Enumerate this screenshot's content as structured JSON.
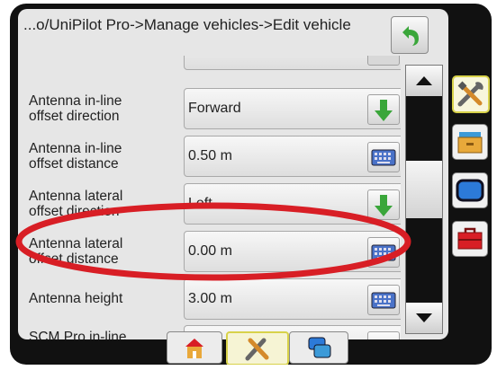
{
  "header": {
    "breadcrumb": "...o/UniPilot Pro->Manage vehicles->Edit vehicle",
    "back_icon": "back-arrow-icon"
  },
  "settings": [
    {
      "label_line1": "Antenna in-line",
      "label_line2": "offset direction",
      "value": "Forward",
      "control": "dropdown"
    },
    {
      "label_line1": "Antenna in-line",
      "label_line2": "offset distance",
      "value": "0.50 m",
      "control": "keyboard"
    },
    {
      "label_line1": "Antenna lateral",
      "label_line2": "offset direction",
      "value": "Left",
      "control": "dropdown"
    },
    {
      "label_line1": "Antenna lateral",
      "label_line2": "offset distance",
      "value": "0.00 m",
      "control": "keyboard"
    },
    {
      "label_line1": "Antenna height",
      "label_line2": "",
      "value": "3.00 m",
      "control": "keyboard"
    },
    {
      "label_line1": "SCM Pro in-line",
      "label_line2": "",
      "value": "",
      "control": "dropdown"
    }
  ],
  "side_tabs": [
    {
      "icon": "tools-icon",
      "selected": true
    },
    {
      "icon": "storage-icon",
      "selected": false
    },
    {
      "icon": "display-icon",
      "selected": false
    },
    {
      "icon": "toolbox-icon",
      "selected": false
    }
  ],
  "bottom_tabs": [
    {
      "icon": "home-icon",
      "selected": false
    },
    {
      "icon": "tools-icon",
      "selected": true
    },
    {
      "icon": "windows-icon",
      "selected": false
    }
  ],
  "highlight": {
    "target": "Antenna lateral offset distance",
    "color": "#d81e25"
  },
  "colors": {
    "accent_green": "#3aa63a",
    "highlight_red": "#d81e25",
    "selection_yellow": "#d8d24a"
  }
}
